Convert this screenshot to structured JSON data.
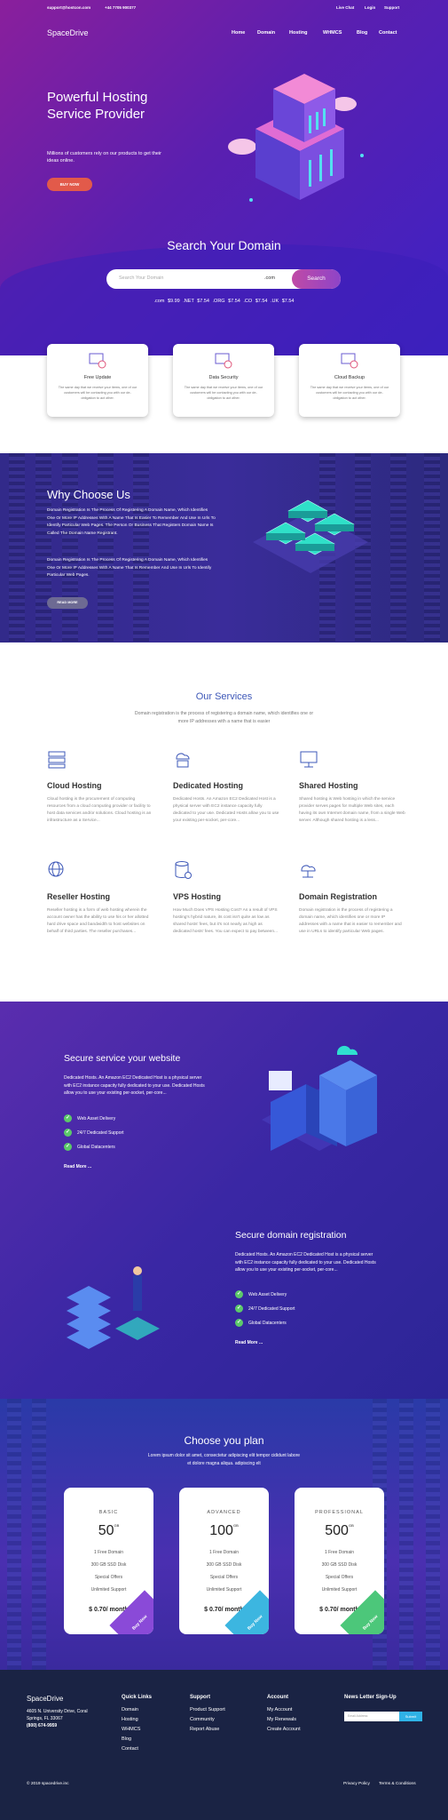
{
  "topbar": {
    "email": "support@hostcon.com",
    "phone": "+44 7705 900377",
    "links": [
      "Live Chat",
      "Login",
      "Support"
    ]
  },
  "header": {
    "logo": "SpaceDrive",
    "nav": [
      "Home",
      "Domain",
      "Hosting",
      "WHMCS",
      "Blog",
      "Contact"
    ]
  },
  "hero": {
    "title": "Powerful Hosting Service Provider",
    "subtitle": "Millions of customers rely on our products to get their ideas online.",
    "button": "BUY NOW"
  },
  "search": {
    "title": "Search Your Domain",
    "placeholder": "Search Your Domain",
    "tld": ".com",
    "button": "Search",
    "prices": ".com  $9.99  .NET  $7.54  .ORG  $7.54  .CO  $7.54  .UK  $7.54"
  },
  "features": [
    {
      "title": "Free Update",
      "desc": "The same day that we receive your items, one of our customers will be contacting you with our de-obligation to act other."
    },
    {
      "title": "Data Security",
      "desc": "The same day that we receive your items, one of our customers will be contacting you with our de-obligation to act other."
    },
    {
      "title": "Cloud Backup",
      "desc": "The same day that we receive your items, one of our customers will be contacting you with our de-obligation to act other."
    }
  ],
  "why": {
    "title": "Why Choose Us",
    "p1": "Domain Registration Is The Process Of Registering A Domain Name, Which Identifies One Or More IP Addresses With A Name That Is Easier To Remember And Use In Urls To Identify Particular Web Pages. The Person Or Business That Registers Domain Name Is Called The Domain Name Registrant.",
    "p2": "Domain Registration Is The Process Of Registering A Domain Name, Which Identifies One Or More IP Addresses With A Name That Is Remember And Use In Urls To Identify Particular Web Pages.",
    "button": "READ MORE"
  },
  "services": {
    "title": "Our Services",
    "subtitle": "Domain registration is the process of registering a domain name, which identifies one or more IP addresses with a name that is easier",
    "items": [
      {
        "title": "Cloud Hosting",
        "desc": "Cloud hosting is the procurement of computing resources from a cloud computing provider or facility to host data services and/or solutions. Cloud hosting is an infrastructure as a Service..."
      },
      {
        "title": "Dedicated Hosting",
        "desc": "Dedicated Hosts. An Amazon EC2 Dedicated Host is a physical server with EC2 instance capacity fully dedicated to your use. Dedicated Hosts allow you to use your existing per-socket, per-core..."
      },
      {
        "title": "Shared Hosting",
        "desc": "Shared hosting is Web hosting in which the service provider serves pages for multiple Web sites, each having its own Internet domain name, from a single Web server. Although shared hosting is a less..."
      },
      {
        "title": "Reseller Hosting",
        "desc": "Reseller hosting is a form of web hosting wherein the account owner has the ability to use his or her allotted hard drive space and bandwidth to host websites on behalf of third parties. The reseller purchases..."
      },
      {
        "title": "VPS Hosting",
        "desc": "How Much Does VPS Hosting Cost? As a result of VPS hosting's hybrid nature, its cost isn't quite as low as shared hosts' fees, but it's not nearly as high as dedicated hosts' fees. You can expect to pay between..."
      },
      {
        "title": "Domain Registration",
        "desc": "Domain registration is the process of registering a domain name, which identifies one or more IP addresses with a name that is easier to remember and use in URLs to identify particular Web pages."
      }
    ]
  },
  "secure": {
    "s1": {
      "title": "Secure service your website",
      "desc": "Dedicated Hosts. An Amazon EC2 Dedicated Host is a physical server with EC2 instance capacity fully dedicated to your use. Dedicated Hosts allow you to use your existing per-socket, per-core...",
      "checks": [
        "Web Asset Delivery",
        "24/7 Dedicated Support",
        "Global Datacenters"
      ],
      "more": "Read More ..."
    },
    "s2": {
      "title": "Secure domain registration",
      "desc": "Dedicated Hosts. An Amazon EC2 Dedicated Host is a physical server with EC2 instance capacity fully dedicated to your use. Dedicated Hosts allow you to use your existing per-socket, per-core...",
      "checks": [
        "Web Asset Delivery",
        "24/7 Dedicated Support",
        "Global Datacenters"
      ],
      "more": "Read More ..."
    }
  },
  "plans": {
    "title": "Choose you plan",
    "subtitle": "Lorem ipsum dolor sit amet, consectetur adipiscing elit tempor cididunt labore et dolore magna aliqua. adipiscing elt",
    "items": [
      {
        "name": "BASIC",
        "price": "50",
        "unit": "GB",
        "lines": [
          "1 Free Domain",
          "300 GB SSD Disk",
          "Special Offers",
          "Unlimited Support"
        ],
        "cost": "$ 0.70/ month",
        "buy": "Buy Now",
        "color": "#8a4ad8"
      },
      {
        "name": "ADVANCED",
        "price": "100",
        "unit": "GB",
        "lines": [
          "1 Free Domain",
          "300 GB SSD Disk",
          "Special Offers",
          "Unlimited Support"
        ],
        "cost": "$ 0.70/ month",
        "buy": "Buy Now",
        "color": "#3cb6e0"
      },
      {
        "name": "PROFESSIONAL",
        "price": "500",
        "unit": "GB",
        "lines": [
          "1 Free Domain",
          "300 GB SSD Disk",
          "Special Offers",
          "Unlimited Support"
        ],
        "cost": "$ 0.70/ month",
        "buy": "Buy Now",
        "color": "#4cc77a"
      }
    ]
  },
  "footer": {
    "logo": "SpaceDrive",
    "address": "4605 N. University Drive, Coral Springs, FL 33067",
    "phone": "(800) 674-9959",
    "cols": [
      {
        "title": "Quick Links",
        "links": [
          "Domain",
          "Hosting",
          "WHMCS",
          "Blog",
          "Contact"
        ]
      },
      {
        "title": "Support",
        "links": [
          "Product Support",
          "Community",
          "Report Abuse"
        ]
      },
      {
        "title": "Account",
        "links": [
          "My Account",
          "My Renewals",
          "Create Account"
        ]
      }
    ],
    "newsletter": {
      "title": "News Letter Sign-Up",
      "placeholder": "Email Address",
      "button": "Submit"
    },
    "copyright": "© 2019 spacedrive.inc",
    "legal": [
      "Privacy Policy",
      "Terms & Conditions"
    ]
  }
}
